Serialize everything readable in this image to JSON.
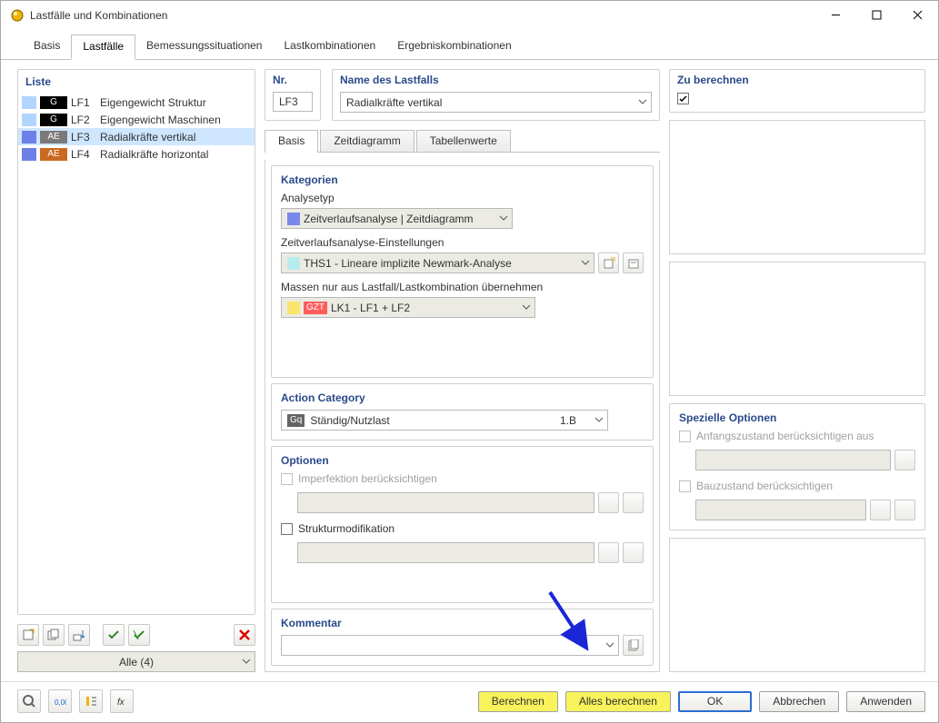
{
  "window": {
    "title": "Lastfälle und Kombinationen"
  },
  "outerTabs": {
    "basis": "Basis",
    "lastfaelle": "Lastfälle",
    "bemessung": "Bemessungssituationen",
    "lastkomb": "Lastkombinationen",
    "ergebnis": "Ergebniskombinationen"
  },
  "liste": {
    "title": "Liste",
    "items": [
      {
        "code": "LF1",
        "badge": "G",
        "name": "Eigengewicht Struktur",
        "c1": "#b2d5ff",
        "c2": "#000"
      },
      {
        "code": "LF2",
        "badge": "G",
        "name": "Eigengewicht Maschinen",
        "c1": "#b2d5ff",
        "c2": "#000"
      },
      {
        "code": "LF3",
        "badge": "AE",
        "name": "Radialkräfte vertikal",
        "c1": "#6d80e7",
        "c2": "#7a7a7a",
        "selected": true
      },
      {
        "code": "LF4",
        "badge": "AE",
        "name": "Radialkräfte horizontal",
        "c1": "#6d80e7",
        "c2": "#c96a20"
      }
    ],
    "filter": "Alle (4)"
  },
  "nr": {
    "label": "Nr.",
    "value": "LF3"
  },
  "name": {
    "label": "Name des Lastfalls",
    "value": "Radialkräfte vertikal"
  },
  "zub": {
    "label": "Zu berechnen",
    "checked": true
  },
  "innerTabs": {
    "basis": "Basis",
    "zeit": "Zeitdiagramm",
    "tab": "Tabellenwerte"
  },
  "kategorien": {
    "title": "Kategorien",
    "analysetyp_label": "Analysetyp",
    "analysetyp_value": "Zeitverlaufsanalyse | Zeitdiagramm",
    "zeit_label": "Zeitverlaufsanalyse-Einstellungen",
    "zeit_value": "THS1 - Lineare implizite Newmark-Analyse",
    "massen_label": "Massen nur aus Lastfall/Lastkombination übernehmen",
    "massen_value": "LK1 - LF1 + LF2",
    "massen_tag": "GZT"
  },
  "action": {
    "title": "Action Category",
    "tag": "Gq",
    "value": "Ständig/Nutzlast",
    "extra": "1.B"
  },
  "optionen": {
    "title": "Optionen",
    "imperfektion": "Imperfektion berücksichtigen",
    "strukturmod": "Strukturmodifikation"
  },
  "spezielle": {
    "title": "Spezielle Optionen",
    "anfangs": "Anfangszustand berücksichtigen aus",
    "bauzustand": "Bauzustand berücksichtigen"
  },
  "kommentar": {
    "title": "Kommentar"
  },
  "footer": {
    "berechnen": "Berechnen",
    "alles": "Alles berechnen",
    "ok": "OK",
    "abbrechen": "Abbrechen",
    "anwenden": "Anwenden"
  }
}
